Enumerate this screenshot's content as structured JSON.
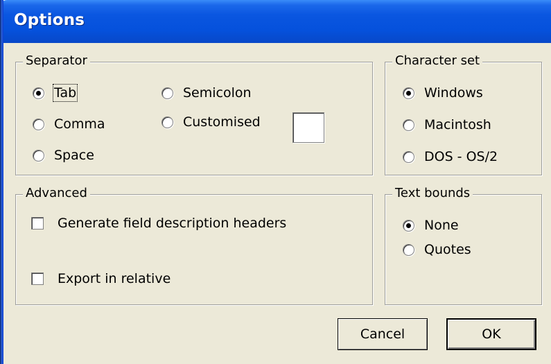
{
  "window": {
    "title": "Options"
  },
  "separator": {
    "legend": "Separator",
    "options": [
      {
        "label": "Tab",
        "checked": true
      },
      {
        "label": "Comma",
        "checked": false
      },
      {
        "label": "Space",
        "checked": false
      },
      {
        "label": "Semicolon",
        "checked": false
      },
      {
        "label": "Customised",
        "checked": false
      }
    ],
    "custom_value": ""
  },
  "charset": {
    "legend": "Character set",
    "options": [
      {
        "label": "Windows",
        "checked": true
      },
      {
        "label": "Macintosh",
        "checked": false
      },
      {
        "label": "DOS - OS/2",
        "checked": false
      }
    ]
  },
  "advanced": {
    "legend": "Advanced",
    "options": [
      {
        "label": "Generate field description headers",
        "checked": false
      },
      {
        "label": "Export in relative",
        "checked": false
      }
    ]
  },
  "text_bounds": {
    "legend": "Text bounds",
    "options": [
      {
        "label": "None",
        "checked": true
      },
      {
        "label": "Quotes",
        "checked": false
      }
    ]
  },
  "buttons": {
    "cancel": "Cancel",
    "ok": "OK"
  }
}
